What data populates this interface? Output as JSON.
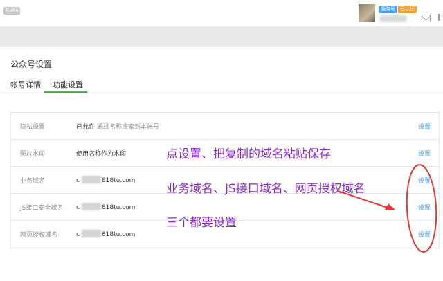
{
  "topbar": {
    "beta_label": "Beta",
    "badge_primary": "服务号",
    "badge_secondary": "已认证",
    "icons": [
      "avatar",
      "mail-icon"
    ]
  },
  "page": {
    "title": "公众号设置",
    "tabs": [
      {
        "label": "帐号详情",
        "active": false
      },
      {
        "label": "功能设置",
        "active": true
      }
    ],
    "active_tab_color": "#44b549"
  },
  "settings": {
    "rows": [
      {
        "label": "隐私设置",
        "value": "已允许",
        "hint": "通过名称搜索到本帐号",
        "action": "设置"
      },
      {
        "label": "图片水印",
        "value": "使用名称作为水印",
        "hint": "",
        "action": "设置"
      },
      {
        "label": "业务域名",
        "value_prefix": "c",
        "value": "818tu.com",
        "hint": "",
        "action": "设置"
      },
      {
        "label": "JS接口安全域名",
        "value_prefix": "c",
        "value": "818tu.com",
        "hint": "",
        "action": "设置"
      },
      {
        "label": "网页授权域名",
        "value_prefix": "c",
        "value": "818tu.com",
        "hint": "",
        "action": "设置"
      }
    ],
    "action_color": "#459ae9"
  },
  "annotations": {
    "line1": "点设置、把复制的域名粘贴保存",
    "line2": "业务域名、JS接口域名、网页授权域名",
    "line3": "三个都要设置",
    "text_color": "#8b2ad0",
    "mark_color": "#e53935"
  }
}
